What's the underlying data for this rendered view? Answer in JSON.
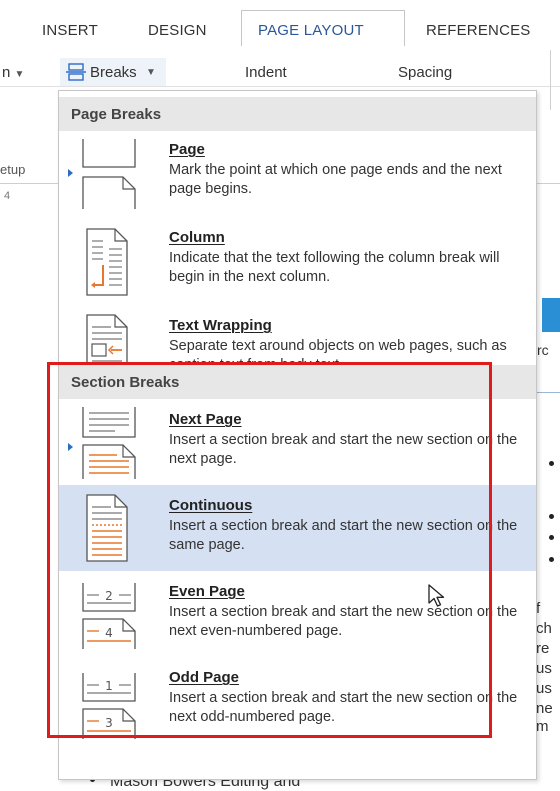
{
  "tabs": {
    "insert": "INSERT",
    "design": "DESIGN",
    "page_layout": "PAGE LAYOUT",
    "references": "REFERENCES"
  },
  "ribbon": {
    "left_fragment": "n",
    "breaks_label": "Breaks",
    "indent_label": "Indent",
    "spacing_label": "Spacing"
  },
  "background": {
    "setup_fragment": "etup",
    "ruler_fragment": "4",
    "right_fragment": "rc",
    "bottom_text": "Mason Bowers Editing and",
    "right_chars": [
      "f",
      "ch",
      "re",
      "us",
      "us",
      "ne",
      "m"
    ]
  },
  "menu": {
    "page_breaks_header": "Page Breaks",
    "section_breaks_header": "Section Breaks",
    "items": [
      {
        "title": "Page",
        "desc": "Mark the point at which one page ends and the next page begins."
      },
      {
        "title": "Column",
        "desc": "Indicate that the text following the column break will begin in the next column."
      },
      {
        "title": "Text Wrapping",
        "desc": "Separate text around objects on web pages, such as caption text from body text."
      },
      {
        "title": "Next Page",
        "desc": "Insert a section break and start the new section on the next page."
      },
      {
        "title": "Continuous",
        "desc": "Insert a section break and start the new section on the same page."
      },
      {
        "title": "Even Page",
        "desc": "Insert a section break and start the new section on the next even-numbered page."
      },
      {
        "title": "Odd Page",
        "desc": "Insert a section break and start the new section on the next odd-numbered page."
      }
    ]
  },
  "colors": {
    "accent": "#2b579a",
    "highlight": "#d5e1f2",
    "annotation": "#e01b1b",
    "icon_orange": "#e8772e"
  }
}
